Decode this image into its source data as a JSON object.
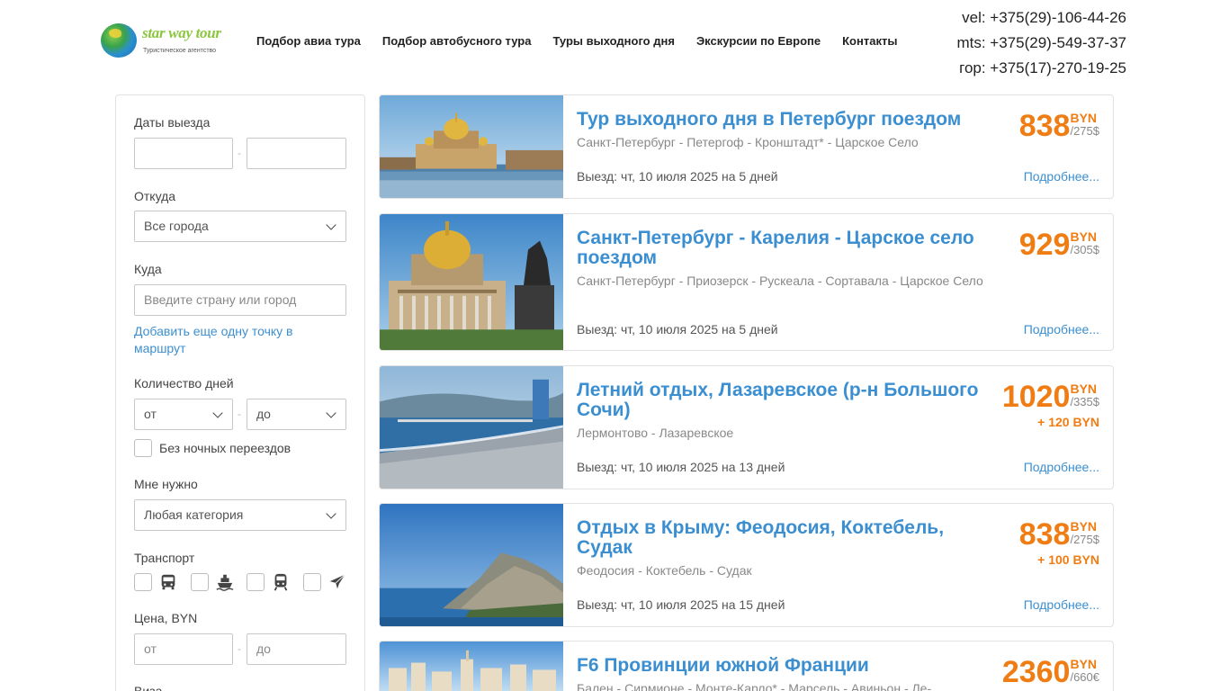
{
  "logo": {
    "name": "star way tour",
    "tagline": "Туристическое агентство"
  },
  "nav": [
    {
      "label": "Подбор авиа тура"
    },
    {
      "label": "Подбор автобусного тура"
    },
    {
      "label": "Туры выходного дня"
    },
    {
      "label": "Экскурсии по Европе"
    },
    {
      "label": "Контакты"
    }
  ],
  "phones": [
    "vel: +375(29)-106-44-26",
    "mts: +375(29)-549-37-37",
    "гор: +375(17)-270-19-25"
  ],
  "filter": {
    "dates_label": "Даты выезда",
    "from_label": "Откуда",
    "from_value": "Все города",
    "to_label": "Куда",
    "to_placeholder": "Введите страну или город",
    "add_point_link": "Добавить еще одну точку в маршрут",
    "days_label": "Количество дней",
    "days_from": "от",
    "days_to": "до",
    "no_night_label": "Без ночных переездов",
    "need_label": "Мне нужно",
    "need_value": "Любая категория",
    "transport_label": "Транспорт",
    "price_label": "Цена, BYN",
    "price_from": "от",
    "price_to": "до",
    "visa_label": "Виза",
    "dash": "-"
  },
  "tours": [
    {
      "title": "Тур выходного дня в Петербург поездом",
      "route": "Санкт-Петербург - Петергоф - Кронштадт* - Царское Село",
      "date": "Выезд: чт, 10 июля 2025 на 5 дней",
      "price": "838",
      "currency": "BYN",
      "usd": "/275$",
      "extra": "",
      "more": "Подробнее..."
    },
    {
      "title": "Санкт-Петербург - Карелия - Царское село поездом",
      "route": "Санкт-Петербург - Приозерск - Рускеала - Сортавала - Царское Село",
      "date": "Выезд: чт, 10 июля 2025 на 5 дней",
      "price": "929",
      "currency": "BYN",
      "usd": "/305$",
      "extra": "",
      "more": "Подробнее..."
    },
    {
      "title": "Летний отдых, Лазаревское (р-н Большого Сочи)",
      "route": "Лермонтово - Лазаревское",
      "date": "Выезд: чт, 10 июля 2025 на 13 дней",
      "price": "1020",
      "currency": "BYN",
      "usd": "/335$",
      "extra": "+ 120 BYN",
      "more": "Подробнее..."
    },
    {
      "title": "Отдых в Крыму: Феодосия, Коктебель, Судак",
      "route": "Феодосия - Коктебель - Судак",
      "date": "Выезд: чт, 10 июля 2025 на 15 дней",
      "price": "838",
      "currency": "BYN",
      "usd": "/275$",
      "extra": "+ 100 BYN",
      "more": "Подробнее..."
    },
    {
      "title": "F6 Провинции южной Франции",
      "route": "Бален - Сирмионе - Монте-Карло* - Марсель - Авиньон - Ле-",
      "date": "",
      "price": "2360",
      "currency": "BYN",
      "usd": "/660€",
      "extra": "",
      "more": ""
    }
  ]
}
